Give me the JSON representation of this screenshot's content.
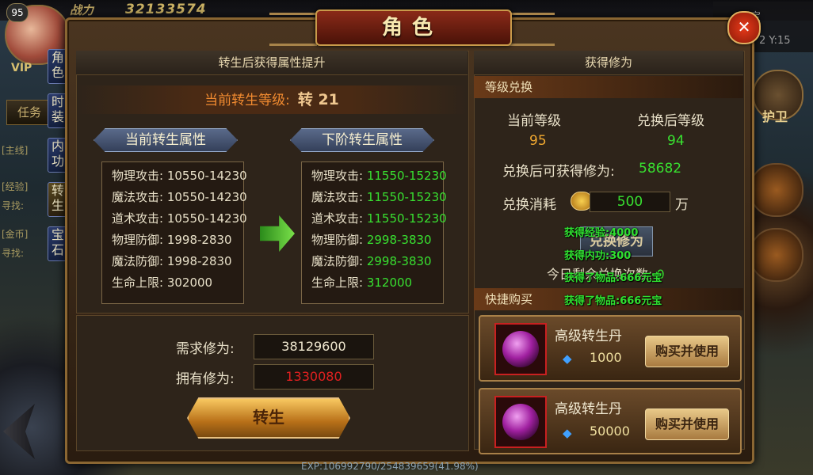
{
  "hud": {
    "player_level": "95",
    "combat_label": "战力",
    "combat_power": "32133574",
    "vip_label": "VIP",
    "side_tabs": [
      "角色",
      "时装",
      "内功",
      "转生",
      "宝石"
    ],
    "task_button": "任务",
    "left_strip": [
      "[主线]",
      "[经验]",
      "寻找:",
      "[金币]",
      "寻找:"
    ],
    "top_right_text": "元宝",
    "top_right_coord": "2 Y:15",
    "guard_label": "护卫"
  },
  "window": {
    "title": "角色",
    "close_glyph": "✕"
  },
  "rebirth_panel": {
    "header": "转生后获得属性提升",
    "current_level_label": "当前转生等级:",
    "current_level_value": "转 21",
    "current_attr_tag": "当前转生属性",
    "next_attr_tag": "下阶转生属性",
    "current_attrs": [
      {
        "name": "物理攻击:",
        "value": "10550-14230"
      },
      {
        "name": "魔法攻击:",
        "value": "10550-14230"
      },
      {
        "name": "道术攻击:",
        "value": "10550-14230"
      },
      {
        "name": "物理防御:",
        "value": "1998-2830"
      },
      {
        "name": "魔法防御:",
        "value": "1998-2830"
      },
      {
        "name": "生命上限:",
        "value": "302000"
      }
    ],
    "next_attrs": [
      {
        "name": "物理攻击:",
        "value": "11550-15230"
      },
      {
        "name": "魔法攻击:",
        "value": "11550-15230"
      },
      {
        "name": "道术攻击:",
        "value": "11550-15230"
      },
      {
        "name": "物理防御:",
        "value": "2998-3830"
      },
      {
        "name": "魔法防御:",
        "value": "2998-3830"
      },
      {
        "name": "生命上限:",
        "value": "312000"
      }
    ],
    "required_label": "需求修为:",
    "required_value": "38129600",
    "owned_label": "拥有修为:",
    "owned_value": "1330080",
    "rebirth_button": "转生"
  },
  "cultivation_panel": {
    "header": "获得修为",
    "exchange_section": "等级兑换",
    "current_level_label": "当前等级",
    "after_level_label": "兑换后等级",
    "current_level": "95",
    "after_level": "94",
    "gain_label": "兑换后可获得修为:",
    "gain_value": "58682",
    "cost_label": "兑换消耗",
    "cost_value": "500",
    "cost_unit": "万",
    "exchange_button": "兑换修为",
    "today_text": "今日剩余兑换次数:",
    "today_count": "0",
    "float_messages": [
      "获得经验:4000",
      "获得内功:300",
      "获得了物品:666元宝",
      "获得了物品:666元宝"
    ],
    "quick_buy_section": "快捷购买",
    "items": [
      {
        "name": "高级转生丹",
        "price": "1000",
        "buy_label": "购买并使用"
      },
      {
        "name": "高级转生丹",
        "price": "50000",
        "buy_label": "购买并使用"
      }
    ]
  },
  "footer": {
    "exp_text": "EXP:106992790/254839659(41.98%)"
  },
  "colors": {
    "accent_gold": "#c89a4a",
    "next_value_green": "#38e030",
    "owned_value_red": "#e02020",
    "title_red": "#8a2a18"
  }
}
